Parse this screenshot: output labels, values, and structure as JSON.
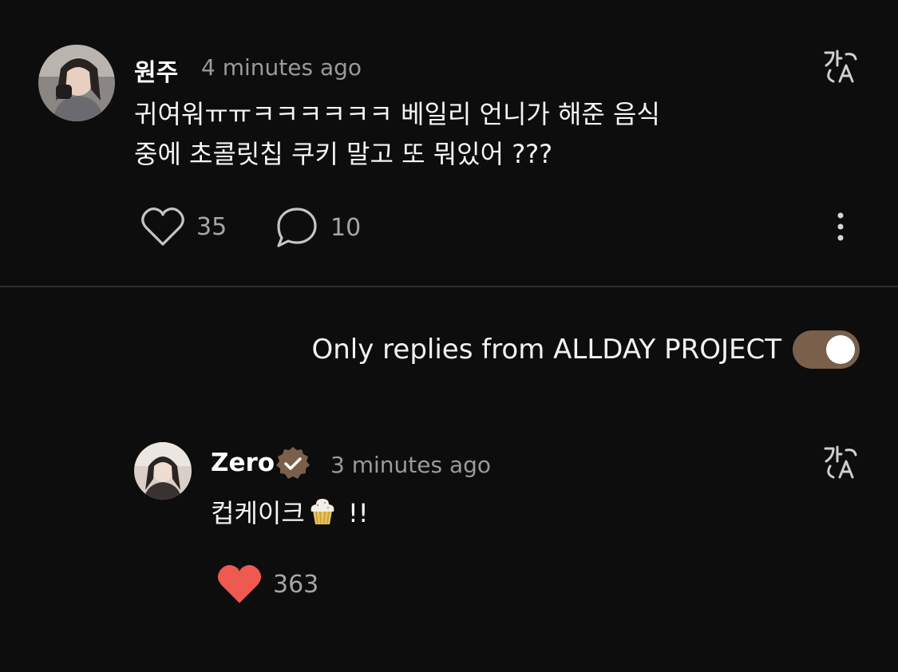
{
  "comment": {
    "username": "원주",
    "timestamp": "4 minutes ago",
    "text_line1": "귀여워ㅠㅠㅋㅋㅋㅋㅋㅋ 베일리 언니가 해준 음식",
    "text_line2": "중에 초콜릿칩 쿠키 말고 또 뭐있어 ???",
    "likes": "35",
    "replies": "10",
    "translate_icon": "translate-icon",
    "more_icon": "more-vertical-icon"
  },
  "filter": {
    "label": "Only replies from ALLDAY PROJECT",
    "enabled": true,
    "toggle_color": "#7a5f4a"
  },
  "reply": {
    "username": "Zero",
    "verified": true,
    "timestamp": "3 minutes ago",
    "text_before": "컵케이크",
    "emoji": "cupcake",
    "text_after": " !!",
    "likes": "363",
    "liked": true,
    "like_color": "#ee5a4f",
    "badge_color": "#7a5f4a"
  }
}
